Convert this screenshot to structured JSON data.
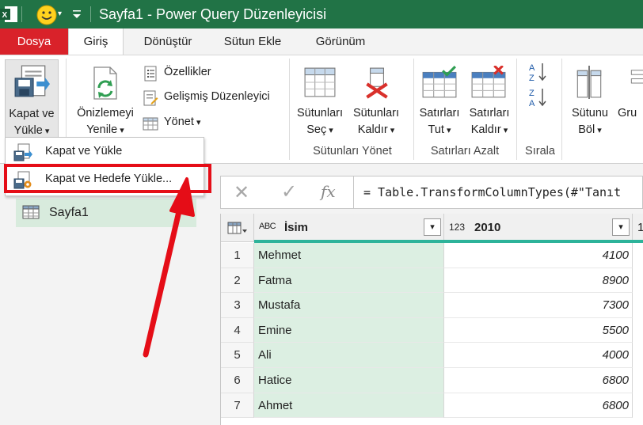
{
  "window": {
    "title": "Sayfa1 - Power Query Düzenleyicisi"
  },
  "tabs": [
    {
      "label": "Dosya"
    },
    {
      "label": "Giriş"
    },
    {
      "label": "Dönüştür"
    },
    {
      "label": "Sütun Ekle"
    },
    {
      "label": "Görünüm"
    }
  ],
  "ribbon": {
    "close_load": {
      "line1": "Kapat ve",
      "line2": "Yükle"
    },
    "refresh_preview": {
      "line1": "Önizlemeyi",
      "line2": "Yenile"
    },
    "properties": "Özellikler",
    "advanced_editor": "Gelişmiş Düzenleyici",
    "manage": "Yönet",
    "choose_columns": {
      "line1": "Sütunları",
      "line2": "Seç"
    },
    "remove_columns": {
      "line1": "Sütunları",
      "line2": "Kaldır"
    },
    "keep_rows": {
      "line1": "Satırları",
      "line2": "Tut"
    },
    "remove_rows": {
      "line1": "Satırları",
      "line2": "Kaldır"
    },
    "split_column": {
      "line1": "Sütunu",
      "line2": "Böl"
    },
    "group_by_partial": "Gru",
    "groups": {
      "manage_columns": "Sütunları Yönet",
      "reduce_rows": "Satırları Azalt",
      "sort": "Sırala"
    }
  },
  "menu": {
    "items": [
      {
        "label": "Kapat ve Yükle"
      },
      {
        "label": "Kapat ve Hedefe Yükle..."
      }
    ]
  },
  "queries": {
    "items": [
      {
        "label": "Sayfa1"
      }
    ]
  },
  "formula_bar": {
    "formula": "= Table.TransformColumnTypes(#\"Tanıt"
  },
  "table": {
    "columns": [
      {
        "type_label": "ABC",
        "name": "İsim"
      },
      {
        "type_label": "123",
        "name": "2010"
      },
      {
        "name": "1"
      }
    ],
    "rows": [
      {
        "n": "1",
        "name": "Mehmet",
        "v2010": "4100"
      },
      {
        "n": "2",
        "name": "Fatma",
        "v2010": "8900"
      },
      {
        "n": "3",
        "name": "Mustafa",
        "v2010": "7300"
      },
      {
        "n": "4",
        "name": "Emine",
        "v2010": "5500"
      },
      {
        "n": "5",
        "name": "Ali",
        "v2010": "4000"
      },
      {
        "n": "6",
        "name": "Hatice",
        "v2010": "6800"
      },
      {
        "n": "7",
        "name": "Ahmet",
        "v2010": "6800"
      }
    ]
  },
  "colors": {
    "title_bar": "#217346",
    "file_tab": "#d9222a",
    "highlight": "#e50d17",
    "column_accent": "#2db39a",
    "selected_column": "#dcefe2"
  }
}
